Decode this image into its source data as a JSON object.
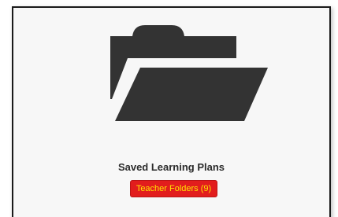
{
  "panel": {
    "icon": "open-folder-icon",
    "title": "Saved Learning Plans",
    "button_label": "Teacher Folders (9)"
  },
  "colors": {
    "icon": "#333333",
    "title_text": "#2b2b2b",
    "button_background": "#e21d1d",
    "button_text": "#ffe400",
    "card_background": "#f7f7f7"
  }
}
